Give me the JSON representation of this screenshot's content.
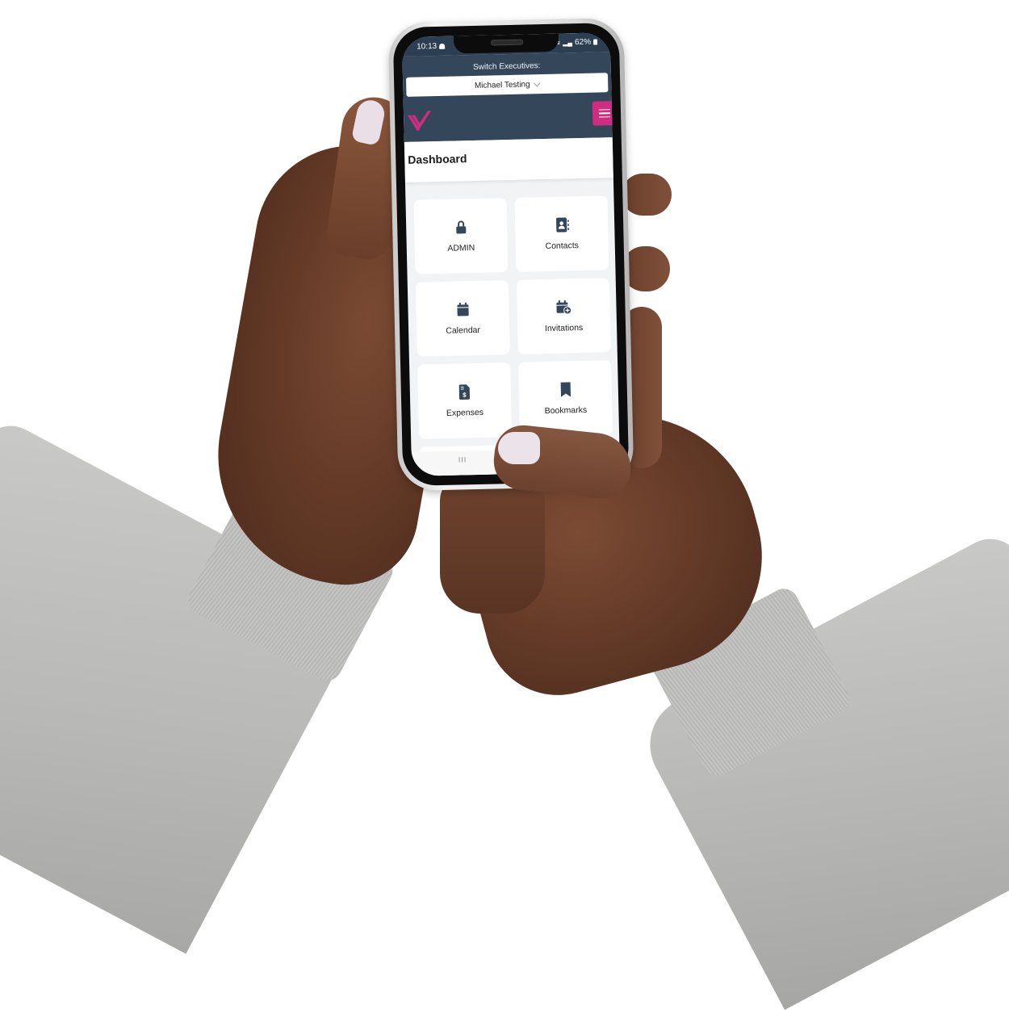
{
  "status_bar": {
    "time": "10:13",
    "battery": "62%",
    "icons": [
      "notification-bell-icon",
      "wifi-icon",
      "signal-icon",
      "battery-icon"
    ]
  },
  "header": {
    "switch_label": "Switch Executives:",
    "selected_executive": "Michael Testing",
    "menu_icon": "hamburger-menu-icon",
    "logo": "v-logo",
    "brand_color": "#cf2c82",
    "header_color": "#34475a"
  },
  "page": {
    "title": "Dashboard"
  },
  "tiles": [
    {
      "label": "ADMIN",
      "icon": "lock-icon"
    },
    {
      "label": "Contacts",
      "icon": "address-book-icon"
    },
    {
      "label": "Calendar",
      "icon": "calendar-icon"
    },
    {
      "label": "Invitations",
      "icon": "calendar-plus-icon"
    },
    {
      "label": "Expenses",
      "icon": "invoice-dollar-icon"
    },
    {
      "label": "Bookmarks",
      "icon": "bookmark-icon"
    }
  ],
  "nav": {
    "home_indicator": "III"
  }
}
